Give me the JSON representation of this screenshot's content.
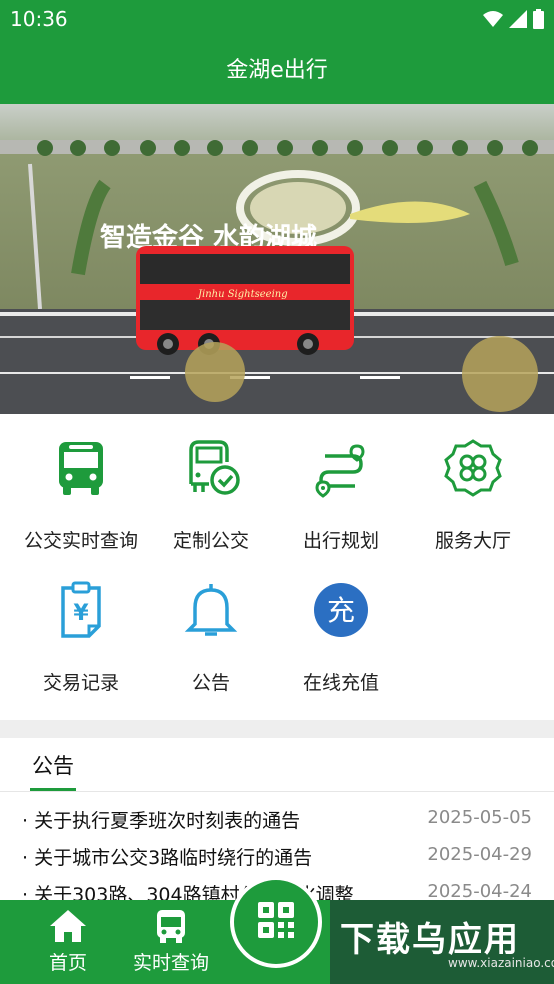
{
  "status": {
    "time": "10:36"
  },
  "header": {
    "title": "金湖e出行"
  },
  "banner": {
    "slogan": "智造金谷 水韵湖城",
    "bus_text": "Jinhu Sightseeing",
    "slide_count": 4,
    "active_slide": 1
  },
  "menu": [
    {
      "label": "公交实时查询",
      "icon": "bus-icon"
    },
    {
      "label": "定制公交",
      "icon": "custom-bus-icon"
    },
    {
      "label": "出行规划",
      "icon": "route-plan-icon"
    },
    {
      "label": "服务大厅",
      "icon": "service-hall-icon"
    },
    {
      "label": "交易记录",
      "icon": "transaction-record-icon"
    },
    {
      "label": "公告",
      "icon": "bell-icon"
    },
    {
      "label": "在线充值",
      "icon": "recharge-icon"
    }
  ],
  "notices": {
    "tab_label": "公告",
    "items": [
      {
        "title": "· 关于执行夏季班次时刻表的通告",
        "date": "2025-05-05"
      },
      {
        "title": "· 关于城市公交3路临时绕行的通告",
        "date": "2025-04-29"
      },
      {
        "title": "· 关于303路、304路镇村公交优化调整",
        "date": "2025-04-24"
      }
    ]
  },
  "bottom_nav": {
    "home": "首页",
    "realtime": "实时查询"
  },
  "watermark": {
    "text": "下载乌应用",
    "url": "www.xiazainiao.com"
  },
  "colors": {
    "primary": "#1e9b3c",
    "icon_green": "#1e9b3c",
    "icon_blue": "#2a9fd8",
    "recharge_blue": "#2b6fc2"
  }
}
